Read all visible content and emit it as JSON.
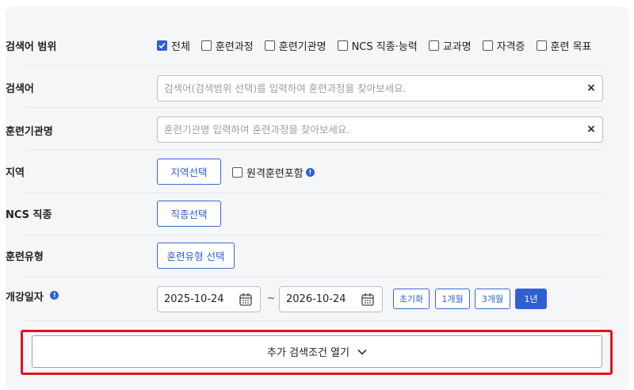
{
  "scope": {
    "label": "검색어 범위",
    "options": [
      {
        "label": "전체",
        "checked": true
      },
      {
        "label": "훈련과정",
        "checked": false
      },
      {
        "label": "훈련기관명",
        "checked": false
      },
      {
        "label": "NCS 직종·능력",
        "checked": false
      },
      {
        "label": "교과명",
        "checked": false
      },
      {
        "label": "자격증",
        "checked": false
      },
      {
        "label": "훈련 목표",
        "checked": false
      }
    ]
  },
  "keyword": {
    "label": "검색어",
    "value": "",
    "placeholder": "검색어(검색범위 선택)를 입력하여 훈련과정을 찾아보세요.",
    "clear": "×"
  },
  "institution": {
    "label": "훈련기관명",
    "value": "",
    "placeholder": "훈련기관명 입력하여 훈련과정을 찾아보세요.",
    "clear": "×"
  },
  "region": {
    "label": "지역",
    "button": "지역선택",
    "remote_label": "원격훈련포함",
    "remote_checked": false,
    "info": "!"
  },
  "ncs": {
    "label": "NCS 직종",
    "button": "직종선택"
  },
  "train_type": {
    "label": "훈련유형",
    "button": "훈련유형 선택"
  },
  "start_date": {
    "label": "개강일자",
    "info": "!",
    "from": "2025-10-24",
    "separator": "~",
    "to": "2026-10-24",
    "periods": [
      {
        "label": "초기화",
        "active": false
      },
      {
        "label": "1개월",
        "active": false
      },
      {
        "label": "3개월",
        "active": false
      },
      {
        "label": "1년",
        "active": true
      }
    ]
  },
  "more": {
    "label": "추가 검색조건 열기"
  },
  "colors": {
    "accent": "#2f5fd0",
    "highlight": "#e0141b",
    "panel_bg": "#f5f6f8"
  }
}
